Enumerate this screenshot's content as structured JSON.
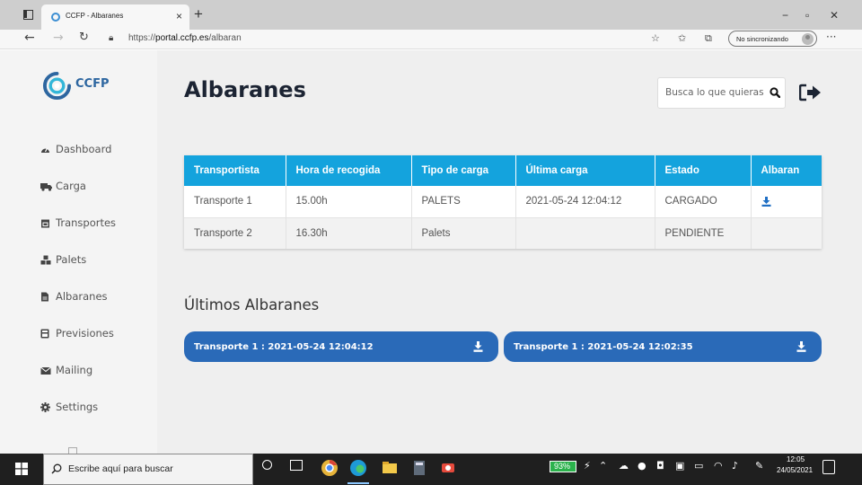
{
  "browser": {
    "tab_title": "CCFP - Albaranes",
    "tab_close": "×",
    "new_tab": "+",
    "window_minimize": "−",
    "window_restore": "▫",
    "window_close": "✕",
    "url_prefix": "https://",
    "url_domain": "portal.ccfp.es",
    "url_path": "/albaran",
    "sync_label": "No sincronizando",
    "more": "···"
  },
  "sidebar": {
    "logo_text": "CCFP",
    "items": [
      {
        "label": "Dashboard",
        "icon": "tachometer-icon"
      },
      {
        "label": "Carga",
        "icon": "truck-icon"
      },
      {
        "label": "Transportes",
        "icon": "calendar-icon"
      },
      {
        "label": "Palets",
        "icon": "cubes-icon"
      },
      {
        "label": "Albaranes",
        "icon": "document-icon"
      },
      {
        "label": "Previsiones",
        "icon": "calculator-icon"
      },
      {
        "label": "Mailing",
        "icon": "envelope-icon"
      },
      {
        "label": "Settings",
        "icon": "gear-icon"
      }
    ]
  },
  "header": {
    "title": "Albaranes",
    "search_placeholder": "Busca lo que quieras"
  },
  "table": {
    "columns": [
      "Transportista",
      "Hora de recogida",
      "Tipo de carga",
      "Última carga",
      "Estado",
      "Albaran"
    ],
    "rows": [
      {
        "transportista": "Transporte 1",
        "hora": "15.00h",
        "tipo": "PALETS",
        "ultima": "2021-05-24 12:04:12",
        "estado": "CARGADO",
        "albaran": "download-icon"
      },
      {
        "transportista": "Transporte 2",
        "hora": "16.30h",
        "tipo": "Palets",
        "ultima": "",
        "estado": "PENDIENTE",
        "albaran": ""
      }
    ]
  },
  "recent": {
    "title": "Últimos Albaranes",
    "cards": [
      {
        "label": "Transporte 1 : 2021-05-24 12:04:12"
      },
      {
        "label": "Transporte 1 : 2021-05-24 12:02:35"
      }
    ]
  },
  "taskbar": {
    "search_text": "Escribe aquí para buscar",
    "battery": "93%",
    "time": "12:05",
    "date": "24/05/2021"
  },
  "colors": {
    "sidebar_bg": "#f4f4f4",
    "main_bg": "#efefef",
    "table_header": "#14a3dd",
    "card_bg": "#2a6ab8",
    "title": "#1c2433",
    "logo": "#2d66a0",
    "download_icon": "#1f6fc4"
  }
}
